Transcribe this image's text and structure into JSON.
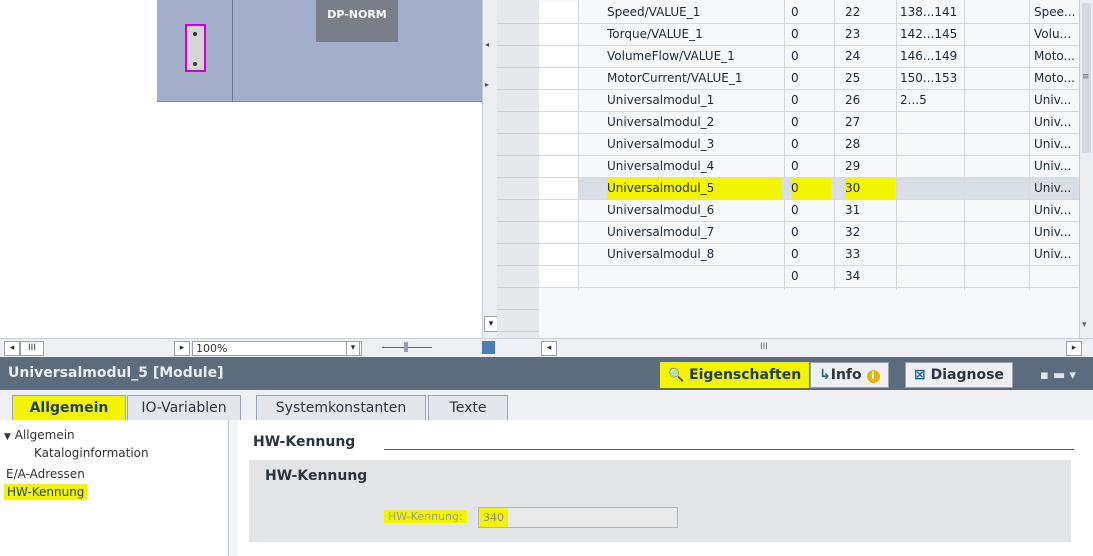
{
  "device": {
    "module_label": "DP-NORM"
  },
  "table": {
    "rows": [
      {
        "name": "Speed/VALUE_1",
        "rack": "0",
        "slot": "22",
        "address": "138...141",
        "type": "Spee..."
      },
      {
        "name": "Torque/VALUE_1",
        "rack": "0",
        "slot": "23",
        "address": "142...145",
        "type": "Volu..."
      },
      {
        "name": "VolumeFlow/VALUE_1",
        "rack": "0",
        "slot": "24",
        "address": "146...149",
        "type": "Moto..."
      },
      {
        "name": "MotorCurrent/VALUE_1",
        "rack": "0",
        "slot": "25",
        "address": "150...153",
        "type": "Moto..."
      },
      {
        "name": "Universalmodul_1",
        "rack": "0",
        "slot": "26",
        "address": "2...5",
        "type": "Univ..."
      },
      {
        "name": "Universalmodul_2",
        "rack": "0",
        "slot": "27",
        "address": "",
        "type": "Univ..."
      },
      {
        "name": "Universalmodul_3",
        "rack": "0",
        "slot": "28",
        "address": "",
        "type": "Univ..."
      },
      {
        "name": "Universalmodul_4",
        "rack": "0",
        "slot": "29",
        "address": "",
        "type": "Univ..."
      },
      {
        "name": "Universalmodul_5",
        "rack": "0",
        "slot": "30",
        "address": "",
        "type": "Univ..."
      },
      {
        "name": "Universalmodul_6",
        "rack": "0",
        "slot": "31",
        "address": "",
        "type": "Univ..."
      },
      {
        "name": "Universalmodul_7",
        "rack": "0",
        "slot": "32",
        "address": "",
        "type": "Univ..."
      },
      {
        "name": "Universalmodul_8",
        "rack": "0",
        "slot": "33",
        "address": "",
        "type": "Univ..."
      },
      {
        "name": "",
        "rack": "0",
        "slot": "34",
        "address": "",
        "type": ""
      }
    ]
  },
  "statusbar": {
    "zoom": "100%",
    "scroll_glyph": "III"
  },
  "properties": {
    "title": "Universalmodul_5 [Module]",
    "tabs_top": {
      "eigenschaften": "Eigenschaften",
      "info": "Info",
      "diagnose": "Diagnose"
    },
    "tabs": [
      "Allgemein",
      "IO-Variablen",
      "Systemkonstanten",
      "Texte"
    ],
    "tree": {
      "allgemein": "Allgemein",
      "kataloginformation": "Kataloginformation",
      "ea_adressen": "E/A-Adressen",
      "hw_kennung": "HW-Kennung"
    },
    "section_title": "HW-Kennung",
    "group_title": "HW-Kennung",
    "field_label": "HW-Kennung:",
    "field_value": "340"
  },
  "colors": {
    "highlight": "#f3f500",
    "header": "#5b6d7d",
    "rack": "#a4aecb"
  },
  "icons": [
    "connector-icon",
    "magnifier-icon",
    "info-icon",
    "diagnose-icon",
    "scroll-left-icon",
    "scroll-right-icon",
    "dropdown-icon",
    "zoom-slider-icon",
    "fit-icon"
  ]
}
